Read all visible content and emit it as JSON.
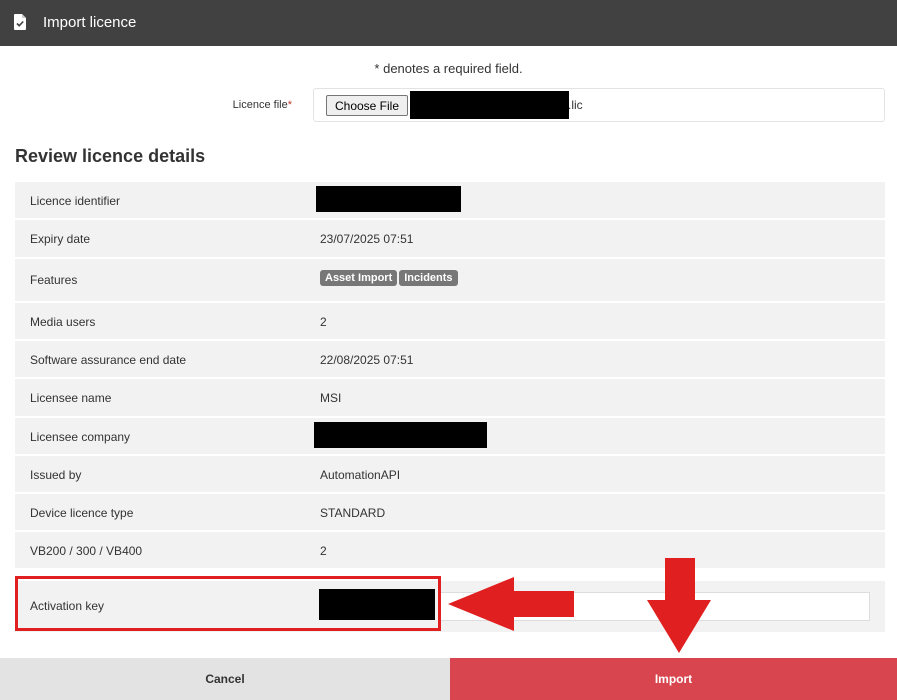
{
  "window": {
    "title": "Import licence",
    "icon": "document-check-icon"
  },
  "form": {
    "required_note_prefix": "* ",
    "required_note": "denotes a required field.",
    "licence_file_label": "Licence file",
    "required_marker": "*",
    "choose_file_label": "Choose File",
    "file_extension": ".lic"
  },
  "review": {
    "title": "Review licence details",
    "rows": [
      {
        "label": "Licence identifier",
        "value": ""
      },
      {
        "label": "Expiry date",
        "value": "23/07/2025 07:51"
      },
      {
        "label": "Features",
        "badges": [
          "Asset Import",
          "Incidents"
        ]
      },
      {
        "label": "Media users",
        "value": "2"
      },
      {
        "label": "Software assurance end date",
        "value": "22/08/2025 07:51"
      },
      {
        "label": "Licensee name",
        "value": "MSI"
      },
      {
        "label": "Licensee company",
        "value": ""
      },
      {
        "label": "Issued by",
        "value": "AutomationAPI"
      },
      {
        "label": "Device licence type",
        "value": "STANDARD"
      },
      {
        "label": "VB200 / 300 / VB400",
        "value": "2"
      }
    ]
  },
  "activation": {
    "label": "Activation key",
    "value": ""
  },
  "footer": {
    "cancel_label": "Cancel",
    "import_label": "Import"
  },
  "colors": {
    "titlebar": "#414141",
    "import_button": "#d9454f",
    "annotation_red": "#e02020",
    "row_background": "#f2f2f2"
  }
}
